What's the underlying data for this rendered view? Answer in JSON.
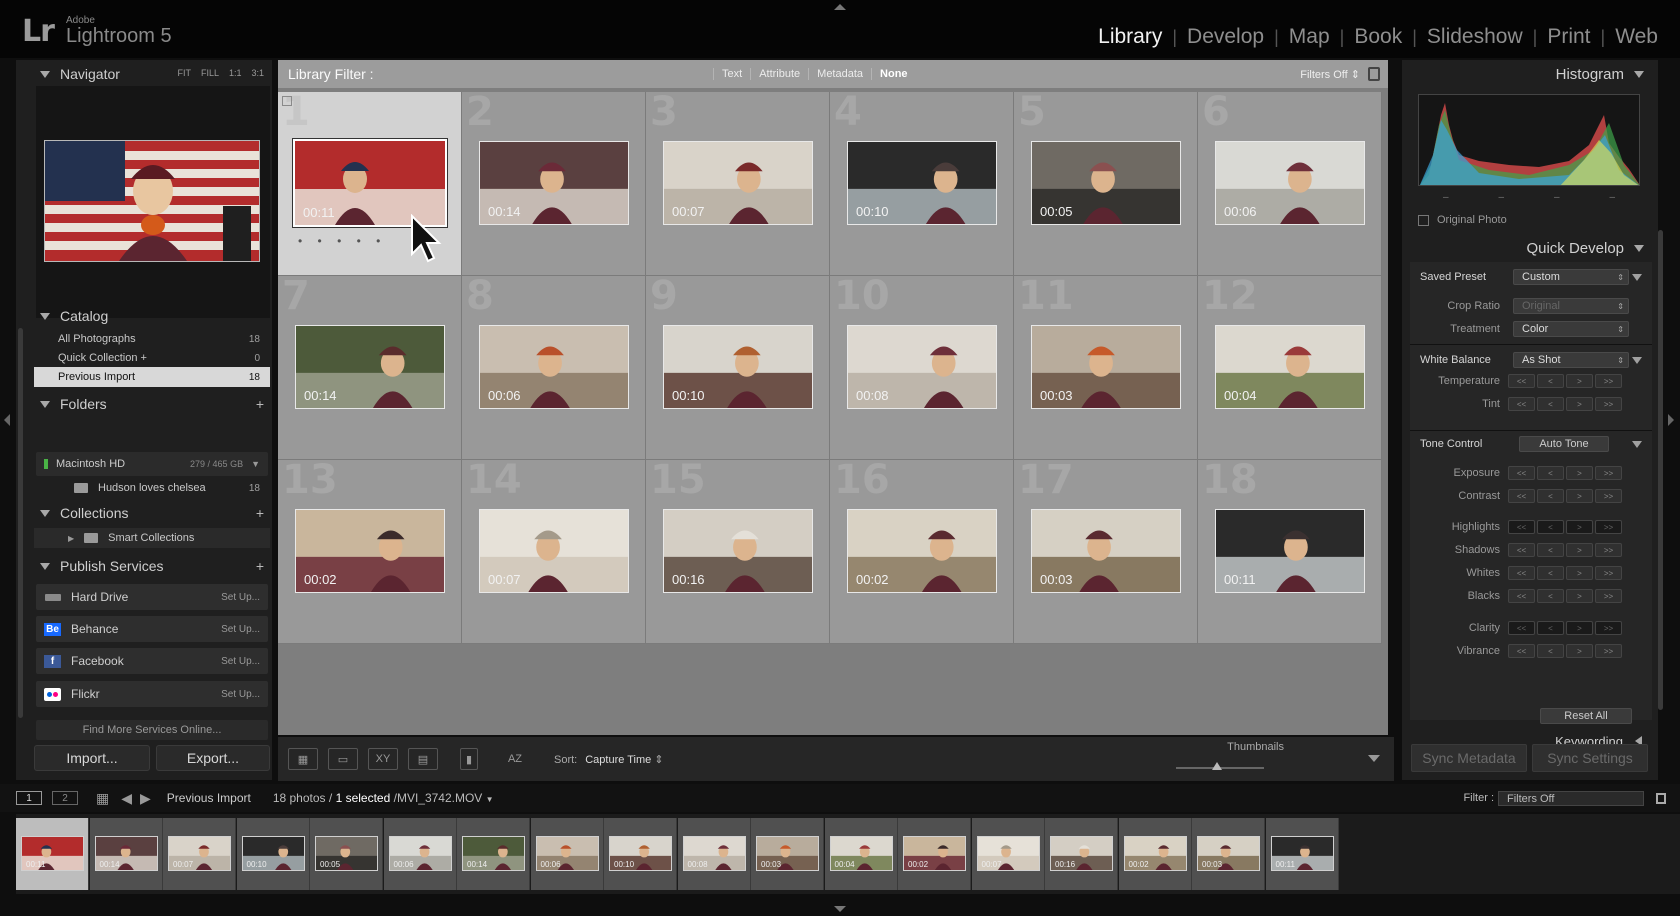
{
  "app": {
    "badge": "Lr",
    "vendor": "Adobe",
    "name": "Lightroom 5",
    "modules": [
      "Library",
      "Develop",
      "Map",
      "Book",
      "Slideshow",
      "Print",
      "Web"
    ],
    "active_module": "Library"
  },
  "navigator": {
    "title": "Navigator",
    "zoom_options": [
      "FIT",
      "FILL",
      "1:1",
      "3:1"
    ]
  },
  "catalog": {
    "title": "Catalog",
    "items": [
      {
        "label": "All Photographs",
        "count": "18"
      },
      {
        "label": "Quick Collection  +",
        "count": "0"
      },
      {
        "label": "Previous Import",
        "count": "18"
      }
    ]
  },
  "folders": {
    "title": "Folders",
    "volume": {
      "label": "Macintosh HD",
      "capacity": "279 / 465 GB"
    },
    "items": [
      {
        "label": "Hudson loves chelsea",
        "count": "18"
      }
    ]
  },
  "collections": {
    "title": "Collections",
    "items": [
      {
        "label": "Smart Collections"
      }
    ]
  },
  "publish": {
    "title": "Publish Services",
    "services": [
      {
        "label": "Hard Drive",
        "setup": "Set Up..."
      },
      {
        "label": "Behance",
        "setup": "Set Up...",
        "icon_text": "Be"
      },
      {
        "label": "Facebook",
        "setup": "Set Up...",
        "icon_text": "f"
      },
      {
        "label": "Flickr",
        "setup": "Set Up..."
      }
    ],
    "find_more": "Find More Services Online..."
  },
  "left_buttons": {
    "import": "Import...",
    "export": "Export..."
  },
  "filter_bar": {
    "label": "Library Filter :",
    "options": [
      "Text",
      "Attribute",
      "Metadata",
      "None"
    ],
    "active": "None",
    "status": "Filters Off"
  },
  "grid": {
    "cells": [
      {
        "index": "1",
        "duration": "00:11",
        "selected": true
      },
      {
        "index": "2",
        "duration": "00:14"
      },
      {
        "index": "3",
        "duration": "00:07"
      },
      {
        "index": "4",
        "duration": "00:10"
      },
      {
        "index": "5",
        "duration": "00:05"
      },
      {
        "index": "6",
        "duration": "00:06"
      },
      {
        "index": "7",
        "duration": "00:14"
      },
      {
        "index": "8",
        "duration": "00:06"
      },
      {
        "index": "9",
        "duration": "00:10"
      },
      {
        "index": "10",
        "duration": "00:08"
      },
      {
        "index": "11",
        "duration": "00:03"
      },
      {
        "index": "12",
        "duration": "00:04"
      },
      {
        "index": "13",
        "duration": "00:02"
      },
      {
        "index": "14",
        "duration": "00:07"
      },
      {
        "index": "15",
        "duration": "00:16"
      },
      {
        "index": "16",
        "duration": "00:02"
      },
      {
        "index": "17",
        "duration": "00:03"
      },
      {
        "index": "18",
        "duration": "00:11"
      }
    ],
    "stars": "• • • • •"
  },
  "toolbar": {
    "sort_label": "Sort:",
    "sort_value": "Capture Time",
    "thumbnails_label": "Thumbnails",
    "compare_label": "XY",
    "sort_icon_label": "AZ"
  },
  "histogram": {
    "title": "Histogram",
    "ticks": [
      "–",
      "–",
      "–",
      "–"
    ],
    "original_photo": "Original Photo"
  },
  "quick_develop": {
    "title": "Quick Develop",
    "saved_preset": {
      "label": "Saved Preset",
      "value": "Custom"
    },
    "crop_ratio": {
      "label": "Crop Ratio",
      "value": "Original"
    },
    "treatment": {
      "label": "Treatment",
      "value": "Color"
    },
    "white_balance": {
      "label": "White Balance",
      "value": "As Shot"
    },
    "temperature": "Temperature",
    "tint": "Tint",
    "tone_control": {
      "label": "Tone Control",
      "button": "Auto Tone"
    },
    "exposure": "Exposure",
    "contrast": "Contrast",
    "highlights": "Highlights",
    "shadows": "Shadows",
    "whites": "Whites",
    "blacks": "Blacks",
    "clarity": "Clarity",
    "vibrance": "Vibrance",
    "reset_all": "Reset All",
    "step_glyphs": [
      "<<",
      "<",
      ">",
      ">>"
    ]
  },
  "keywording": {
    "title": "Keywording"
  },
  "sync": {
    "metadata": "Sync Metadata",
    "settings": "Sync Settings"
  },
  "filmstrip_bar": {
    "monitor1": "1",
    "monitor2": "2",
    "source": "Previous Import",
    "count_text": "18 photos /",
    "selected_text": "1 selected",
    "file_text": "/MVI_3742.MOV",
    "filter_label": "Filter :",
    "filter_value": "Filters Off"
  }
}
